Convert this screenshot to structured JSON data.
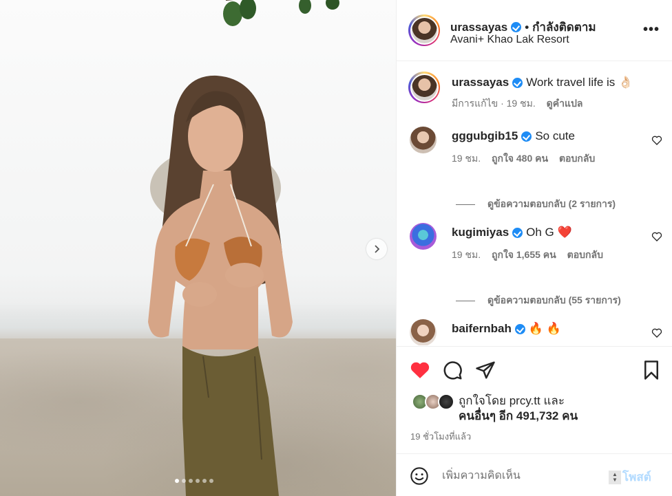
{
  "header": {
    "username": "urassayas",
    "separator": "•",
    "follow_status": "กำลังติดตาม",
    "location": "Avani+ Khao Lak Resort",
    "more_label": "•••"
  },
  "caption": {
    "username": "urassayas",
    "text": "Work travel life is",
    "emoji": "👌🏻",
    "edited": "มีการแก้ไข · 19 ชม.",
    "translate": "ดูคำแปล"
  },
  "comments": [
    {
      "username": "gggubgib15",
      "text": "So cute",
      "time": "19 ชม.",
      "likes": "ถูกใจ 480 คน",
      "reply": "ตอบกลับ",
      "view_replies": "ดูข้อความตอบกลับ (2 รายการ)"
    },
    {
      "username": "kugimiyas",
      "text": "Oh G",
      "emoji": "❤️",
      "time": "19 ชม.",
      "likes": "ถูกใจ 1,655 คน",
      "reply": "ตอบกลับ",
      "view_replies": "ดูข้อความตอบกลับ (55 รายการ)"
    },
    {
      "username": "baifernbah",
      "text": "🔥 🔥"
    }
  ],
  "likes": {
    "line1": "ถูกใจโดย prcy.tt และ",
    "line2": "คนอื่นๆ อีก 491,732 คน"
  },
  "post_time": "19 ชั่วโมงที่แล้ว",
  "composer": {
    "placeholder": "เพิ่มความคิดเห็น",
    "post_label": "โพสต์"
  },
  "carousel": {
    "slides": 6,
    "active_index": 0
  },
  "colors": {
    "like_red": "#ff3040",
    "verified_blue": "#1e8cf5",
    "post_disabled": "#b3dbff"
  }
}
